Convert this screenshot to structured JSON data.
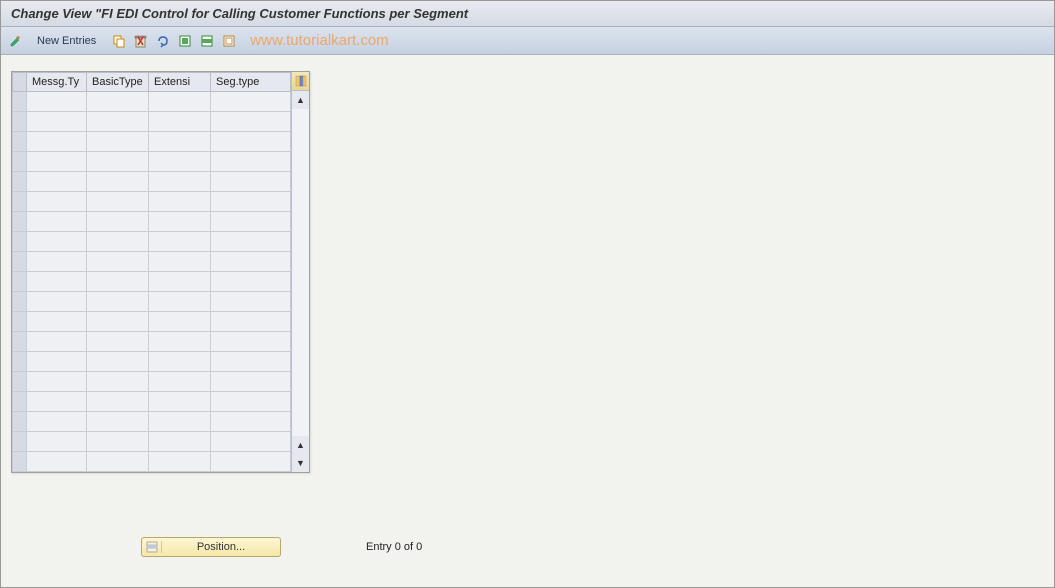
{
  "title": "Change View \"FI EDI Control for Calling Customer Functions per Segment",
  "toolbar": {
    "new_entries_label": "New Entries"
  },
  "watermark": "www.tutorialkart.com",
  "table": {
    "columns": [
      "Messg.Ty",
      "BasicType",
      "Extensi",
      "Seg.type"
    ],
    "row_count": 19
  },
  "footer": {
    "position_label": "Position...",
    "entry_status": "Entry 0 of 0"
  }
}
